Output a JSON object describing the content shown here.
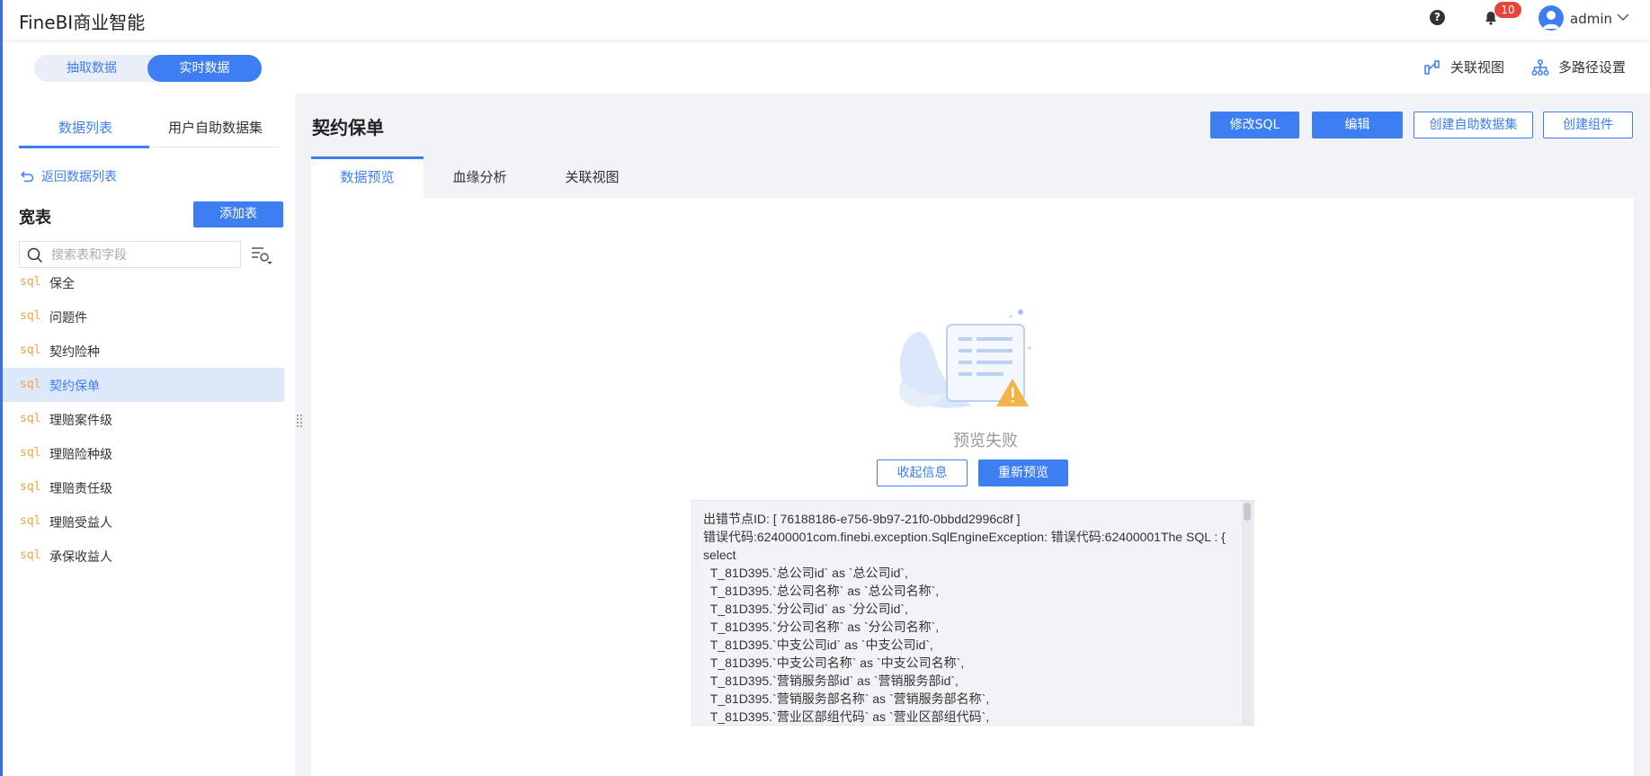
{
  "app": {
    "title": "FineBI商业智能"
  },
  "header": {
    "notifications_count": "10",
    "user_name": "admin"
  },
  "mode": {
    "extract_label": "抽取数据",
    "realtime_label": "实时数据",
    "active": "realtime"
  },
  "top_links": {
    "relation_view": "关联视图",
    "multipath_settings": "多路径设置"
  },
  "sidebar": {
    "tabs": [
      {
        "label": "数据列表",
        "active": true
      },
      {
        "label": "用户自助数据集",
        "active": false
      }
    ],
    "back_label": "返回数据列表",
    "section_title": "宽表",
    "add_table_label": "添加表",
    "search_placeholder": "搜索表和字段",
    "sql_tag": "sql",
    "tables": [
      {
        "name": "保全",
        "selected": false
      },
      {
        "name": "问题件",
        "selected": false
      },
      {
        "name": "契约险种",
        "selected": false
      },
      {
        "name": "契约保单",
        "selected": true
      },
      {
        "name": "理赔案件级",
        "selected": false
      },
      {
        "name": "理赔险种级",
        "selected": false
      },
      {
        "name": "理赔责任级",
        "selected": false
      },
      {
        "name": "理赔受益人",
        "selected": false
      },
      {
        "name": "承保收益人",
        "selected": false
      }
    ]
  },
  "main": {
    "title": "契约保单",
    "actions": {
      "edit_sql": "修改SQL",
      "edit": "编辑",
      "create_dataset": "创建自助数据集",
      "create_component": "创建组件"
    },
    "tabs": [
      {
        "label": "数据预览",
        "active": true
      },
      {
        "label": "血缘分析",
        "active": false
      },
      {
        "label": "关联视图",
        "active": false
      }
    ],
    "preview": {
      "fail_text": "预览失败",
      "collapse_label": "收起信息",
      "retry_label": "重新预览",
      "error_message": "出错节点ID: [ 76188186-e756-9b97-21f0-0bbdd2996c8f ]\n错误代码:62400001com.finebi.exception.SqlEngineException: 错误代码:62400001The SQL : {  select\n  T_81D395.`总公司id` as `总公司id`,\n  T_81D395.`总公司名称` as `总公司名称`,\n  T_81D395.`分公司id` as `分公司id`,\n  T_81D395.`分公司名称` as `分公司名称`,\n  T_81D395.`中支公司id` as `中支公司id`,\n  T_81D395.`中支公司名称` as `中支公司名称`,\n  T_81D395.`营销服务部id` as `营销服务部id`,\n  T_81D395.`营销服务部名称` as `营销服务部名称`,\n  T_81D395.`营业区部组代码` as `营业区部组代码`,"
    }
  },
  "colors": {
    "accent": "#3d7ff2",
    "sql_tag": "#f5a142",
    "selected_row": "#dde9fa",
    "badge": "#e8453c"
  }
}
